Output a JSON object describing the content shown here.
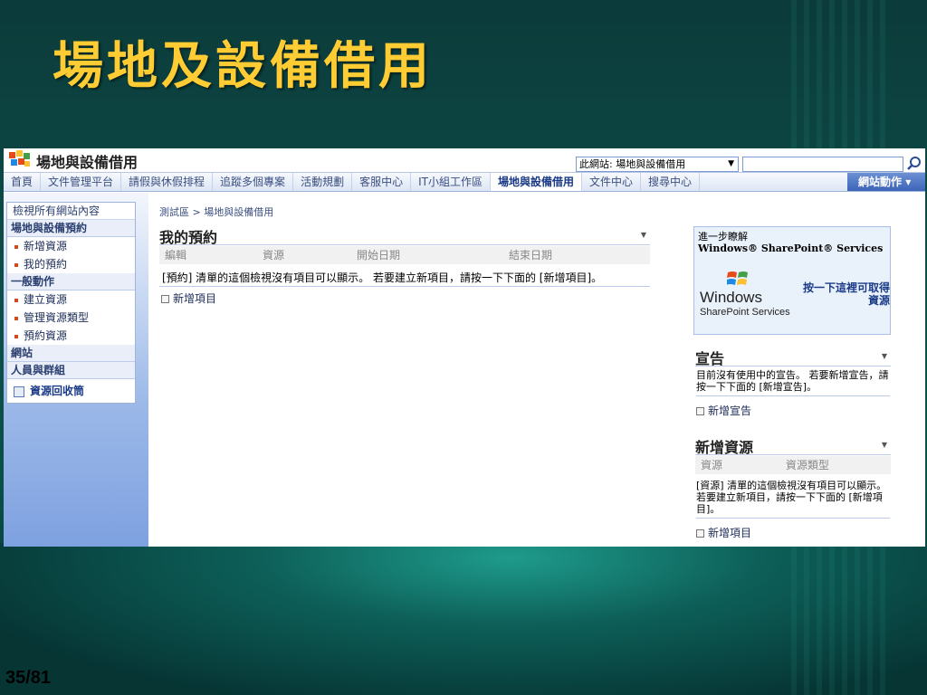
{
  "slide": {
    "title": "場地及設備借用",
    "page_number": "35/81"
  },
  "header": {
    "site_title": "場地與設備借用",
    "logo_icon": "sharepoint-logo-icon",
    "search_scope": "此網站: 場地與設備借用",
    "search_value": ""
  },
  "topnav": {
    "tabs": [
      {
        "label": "首頁"
      },
      {
        "label": "文件管理平台"
      },
      {
        "label": "請假與休假排程"
      },
      {
        "label": "追蹤多個專案"
      },
      {
        "label": "活動規劃"
      },
      {
        "label": "客服中心"
      },
      {
        "label": "IT小組工作區"
      },
      {
        "label": "場地與設備借用"
      },
      {
        "label": "文件中心"
      },
      {
        "label": "搜尋中心"
      }
    ],
    "active_tab": "場地與設備借用",
    "site_actions": "網站動作"
  },
  "quicklaunch": {
    "view_all": "檢視所有網站內容",
    "section1": {
      "heading": "場地與設備預約",
      "items": [
        "新增資源",
        "我的預約"
      ]
    },
    "section2": {
      "heading": "一般動作",
      "items": [
        "建立資源",
        "管理資源類型",
        "預約資源"
      ]
    },
    "section3": {
      "heading": "網站"
    },
    "section4": {
      "heading": "人員與群組"
    },
    "recycle_bin": "資源回收筒"
  },
  "main": {
    "breadcrumb": "測試區 > 場地與設備借用",
    "my_reservations": {
      "title": "我的預約",
      "columns": [
        "編輯",
        "資源",
        "開始日期",
        "結束日期"
      ],
      "empty_message": "[預約] 清單的這個檢視沒有項目可以顯示。 若要建立新項目，請按一下下面的 [新增項目]。",
      "add_link": "新增項目"
    }
  },
  "right": {
    "learn_more": {
      "line1": "進一步瞭解",
      "line2": "Windows® SharePoint® Services",
      "logo_word": "Windows",
      "logo_sub": "SharePoint Services",
      "link": "按一下這裡可取得資源"
    },
    "announcements": {
      "title": "宣告",
      "empty_message": "目前沒有使用中的宣告。 若要新增宣告，請按一下下面的 [新增宣告]。",
      "add_link": "新增宣告"
    },
    "new_resources": {
      "title": "新增資源",
      "columns": [
        "資源",
        "資源類型"
      ],
      "empty_message": "[資源] 清單的這個檢視沒有項目可以顯示。 若要建立新項目，請按一下下面的 [新增項目]。",
      "add_link": "新增項目"
    }
  },
  "colors": {
    "title": "#ffcc33",
    "accent": "#1a3a87",
    "bullet": "#d04a1b"
  }
}
